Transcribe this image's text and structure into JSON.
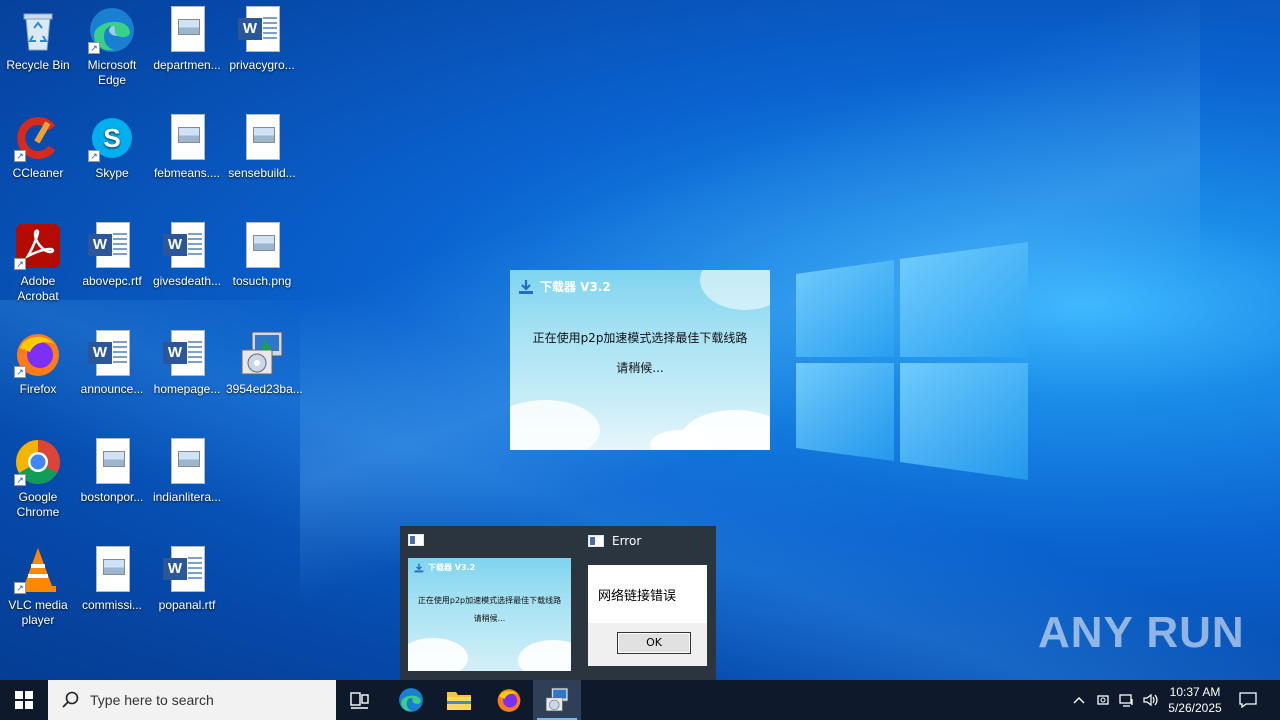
{
  "desktop_icons": [
    {
      "label": "Recycle Bin",
      "icon": "recycle-bin-icon"
    },
    {
      "label": "Microsoft Edge",
      "icon": "edge-icon"
    },
    {
      "label": "departmen...",
      "icon": "image-file-icon"
    },
    {
      "label": "privacygro...",
      "icon": "word-doc-icon"
    },
    {
      "label": "CCleaner",
      "icon": "ccleaner-icon"
    },
    {
      "label": "Skype",
      "icon": "skype-icon"
    },
    {
      "label": "febmeans....",
      "icon": "image-file-icon"
    },
    {
      "label": "sensebuild...",
      "icon": "image-file-icon"
    },
    {
      "label": "Adobe Acrobat",
      "icon": "acrobat-icon"
    },
    {
      "label": "abovepc.rtf",
      "icon": "word-doc-icon"
    },
    {
      "label": "givesdeath...",
      "icon": "word-doc-icon"
    },
    {
      "label": "tosuch.png",
      "icon": "image-file-icon"
    },
    {
      "label": "Firefox",
      "icon": "firefox-icon"
    },
    {
      "label": "announce...",
      "icon": "word-doc-icon"
    },
    {
      "label": "homepage...",
      "icon": "word-doc-icon"
    },
    {
      "label": "3954ed23ba...",
      "icon": "installer-icon"
    },
    {
      "label": "Google Chrome",
      "icon": "chrome-icon"
    },
    {
      "label": "bostonpor...",
      "icon": "image-file-icon"
    },
    {
      "label": "indianlitera...",
      "icon": "image-file-icon"
    },
    {
      "label": "VLC media player",
      "icon": "vlc-icon"
    },
    {
      "label": "commissi...",
      "icon": "image-file-icon"
    },
    {
      "label": "popanal.rtf",
      "icon": "word-doc-icon"
    }
  ],
  "downloader": {
    "title": "下载器 V3.2",
    "message": "正在使用p2p加速模式选择最佳下载线路",
    "wait": "请稍候..."
  },
  "preview": {
    "error_title": "Error",
    "error_message": "网络链接错误",
    "ok_label": "OK"
  },
  "taskbar": {
    "search_placeholder": "Type here to search",
    "time": "10:37 AM",
    "date": "5/26/2025"
  },
  "watermark": "ANY RUN"
}
